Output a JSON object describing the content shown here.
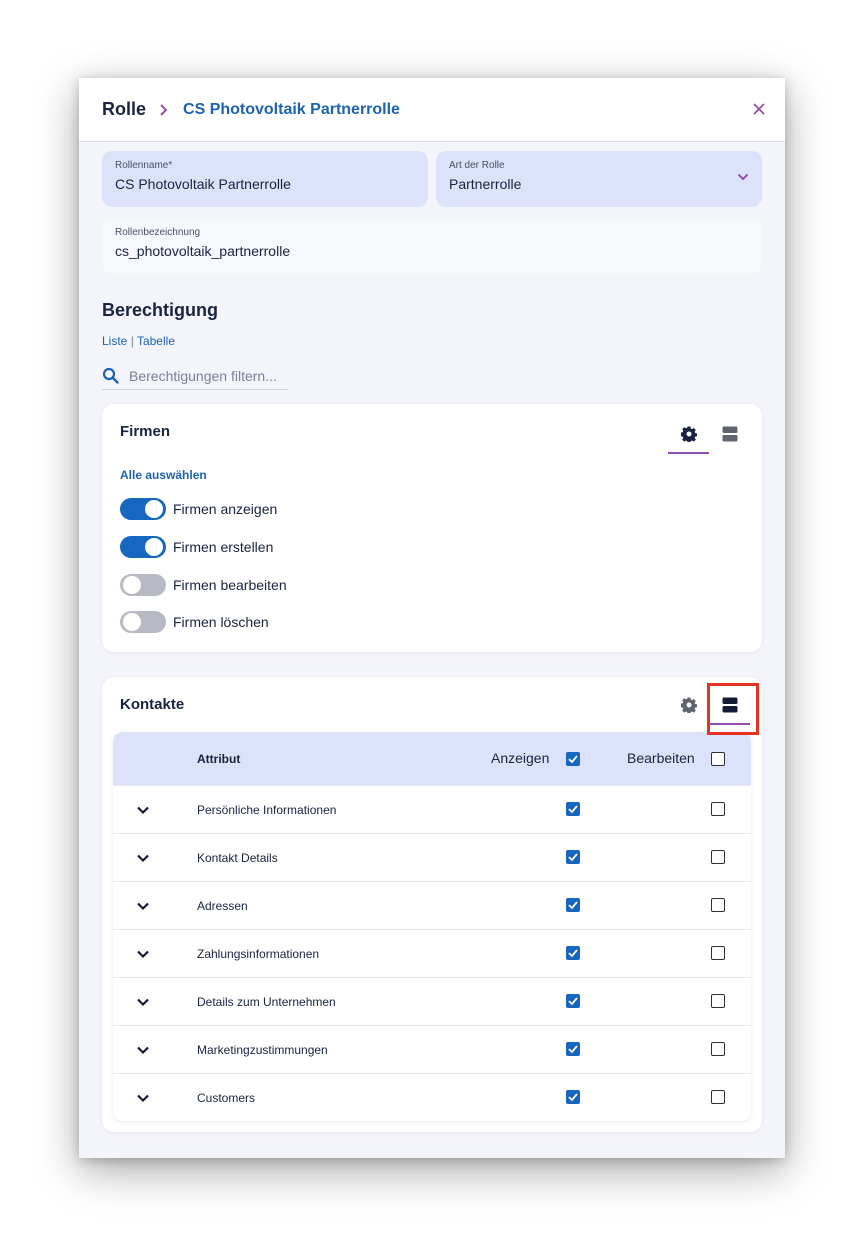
{
  "header": {
    "root": "Rolle",
    "current": "CS Photovoltaik Partnerrolle"
  },
  "form": {
    "role_name": {
      "label": "Rollenname*",
      "value": "CS Photovoltaik Partnerrolle"
    },
    "role_type": {
      "label": "Art der Rolle",
      "value": "Partnerrolle"
    },
    "role_key": {
      "label": "Rollenbezeichnung",
      "value": "cs_photovoltaik_partnerrolle"
    }
  },
  "permissions": {
    "title": "Berechtigung",
    "view_list": "Liste",
    "view_sep": "|",
    "view_table": "Tabelle",
    "search_placeholder": "Berechtigungen filtern..."
  },
  "firmen": {
    "title": "Firmen",
    "select_all": "Alle auswählen",
    "toggles": [
      {
        "label": "Firmen anzeigen",
        "on": true
      },
      {
        "label": "Firmen erstellen",
        "on": true
      },
      {
        "label": "Firmen bearbeiten",
        "on": false
      },
      {
        "label": "Firmen löschen",
        "on": false
      }
    ]
  },
  "kontakte": {
    "title": "Kontakte",
    "columns": {
      "attr": "Attribut",
      "show": "Anzeigen",
      "edit": "Bearbeiten"
    },
    "header_show_checked": true,
    "header_edit_checked": false,
    "rows": [
      {
        "label": "Persönliche Informationen",
        "show": true,
        "edit": false
      },
      {
        "label": "Kontakt Details",
        "show": true,
        "edit": false
      },
      {
        "label": "Adressen",
        "show": true,
        "edit": false
      },
      {
        "label": "Zahlungsinformationen",
        "show": true,
        "edit": false
      },
      {
        "label": "Details zum Unternehmen",
        "show": true,
        "edit": false
      },
      {
        "label": "Marketingzustimmungen",
        "show": true,
        "edit": false
      },
      {
        "label": "Customers",
        "show": true,
        "edit": false
      }
    ]
  },
  "colors": {
    "accent": "#1766c0",
    "link": "#1e63b0",
    "tab_underline": "#9150b0",
    "field_bg": "#dde2fb",
    "highlight": "#e53222"
  },
  "icons": {
    "close": "close-icon",
    "chevron_right": "chevron-right-icon",
    "chevron_down": "chevron-down-icon",
    "search": "search-icon",
    "gear": "gear-icon",
    "table_view": "table-view-icon"
  }
}
